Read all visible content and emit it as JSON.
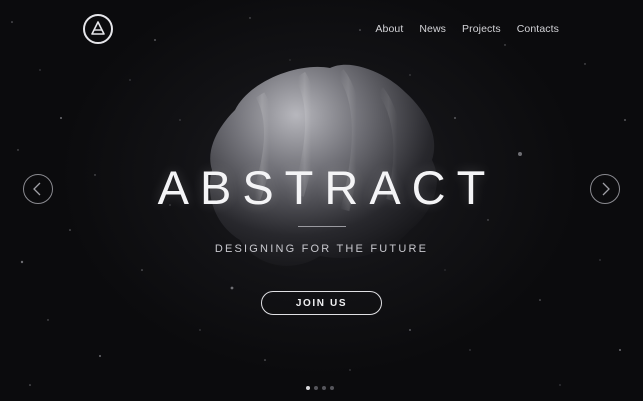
{
  "logo": {
    "glyph": "A",
    "icon": "triangle-a-logo-icon"
  },
  "nav": {
    "items": [
      {
        "label": "About"
      },
      {
        "label": "News"
      },
      {
        "label": "Projects"
      },
      {
        "label": "Contacts"
      }
    ]
  },
  "hero": {
    "title": "ABSTRACT",
    "subtitle": "DESIGNING FOR THE FUTURE",
    "cta_label": "JOIN US"
  },
  "carousel": {
    "prev_icon": "chevron-left-icon",
    "next_icon": "chevron-right-icon",
    "slide_count": 4,
    "active_slide": 1
  },
  "colors": {
    "background": "#0c0c0e",
    "text": "#f4f4f6",
    "muted": "#8a8a90"
  }
}
